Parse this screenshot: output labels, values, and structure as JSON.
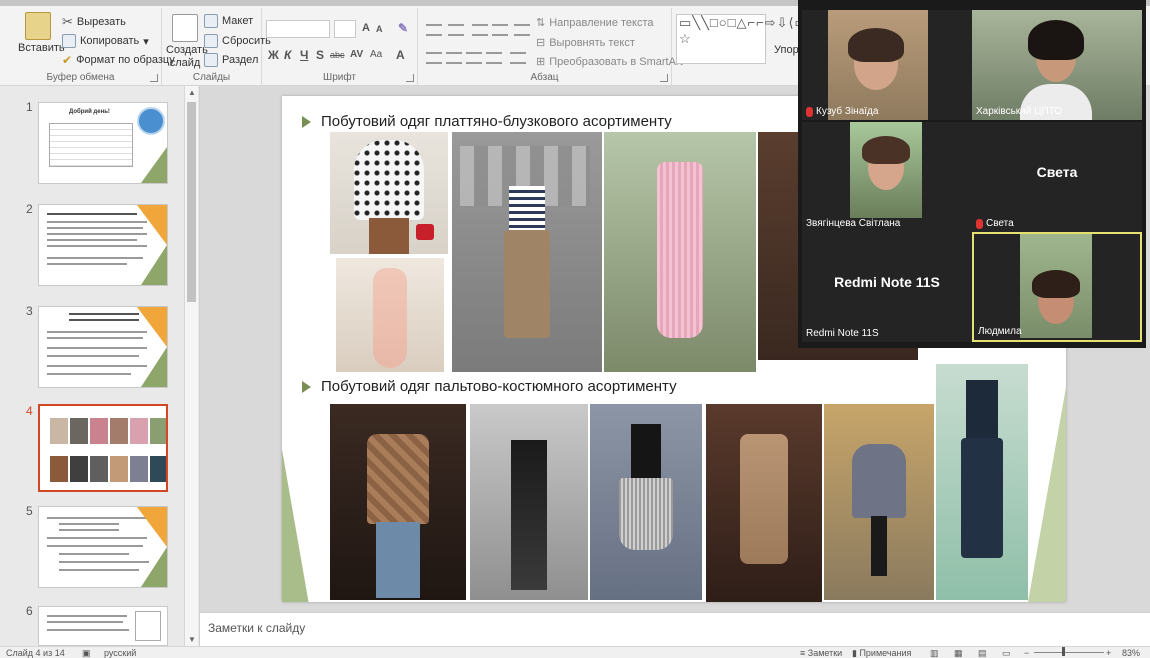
{
  "ribbon": {
    "clipboard": {
      "paste": "Вставить",
      "cut": "Вырезать",
      "copy": "Копировать",
      "format_painter": "Формат по образцу",
      "caption": "Буфер обмена"
    },
    "slides": {
      "new_slide": "Создать слайд",
      "layout": "Макет",
      "reset": "Сбросить",
      "section": "Раздел",
      "caption": "Слайды"
    },
    "font": {
      "caption": "Шрифт",
      "bold": "Ж",
      "italic": "К",
      "underline": "Ч",
      "shadow": "S",
      "strike": "abc",
      "spacing": "AV",
      "case": "Aa",
      "grow": "A",
      "shrink": "A"
    },
    "paragraph": {
      "caption": "Абзац",
      "text_direction": "Направление текста",
      "align_text": "Выровнять текст",
      "smartart": "Преобразовать в SmartArt"
    },
    "drawing": {
      "shapes": "▭╲╲□○□△⌐⌐⇨⇩⟨▭⌐⌐⌒{}☆",
      "arrange": "Упор"
    }
  },
  "thumbnails": {
    "numbers": [
      "1",
      "2",
      "3",
      "4",
      "5",
      "6"
    ],
    "slide1_title": "Добрий день!",
    "selected_index": 4
  },
  "slide": {
    "heading1": "Побутовий одяг платтяно-блузкового асортименту",
    "heading2": "Побутовий одяг пальтово-костюмного асортименту"
  },
  "notes": {
    "placeholder": "Заметки к слайду"
  },
  "status": {
    "slide_info": "Слайд 4 из 14",
    "language": "русский",
    "notes": "Заметки",
    "comments": "Примечания",
    "zoom": "83%"
  },
  "video": {
    "participants": [
      {
        "name": "Кузуб Зінаїда",
        "muted": true
      },
      {
        "name": "Харківський ЦПТО",
        "muted": false
      },
      {
        "name": "Звягінцева Світлана",
        "muted": false
      },
      {
        "name": "Света",
        "muted": true,
        "big_label": "Света"
      },
      {
        "name": "Redmi Note 11S",
        "muted": false,
        "big_label": "Redmi Note 11S"
      },
      {
        "name": "Людмила",
        "muted": false
      }
    ]
  }
}
